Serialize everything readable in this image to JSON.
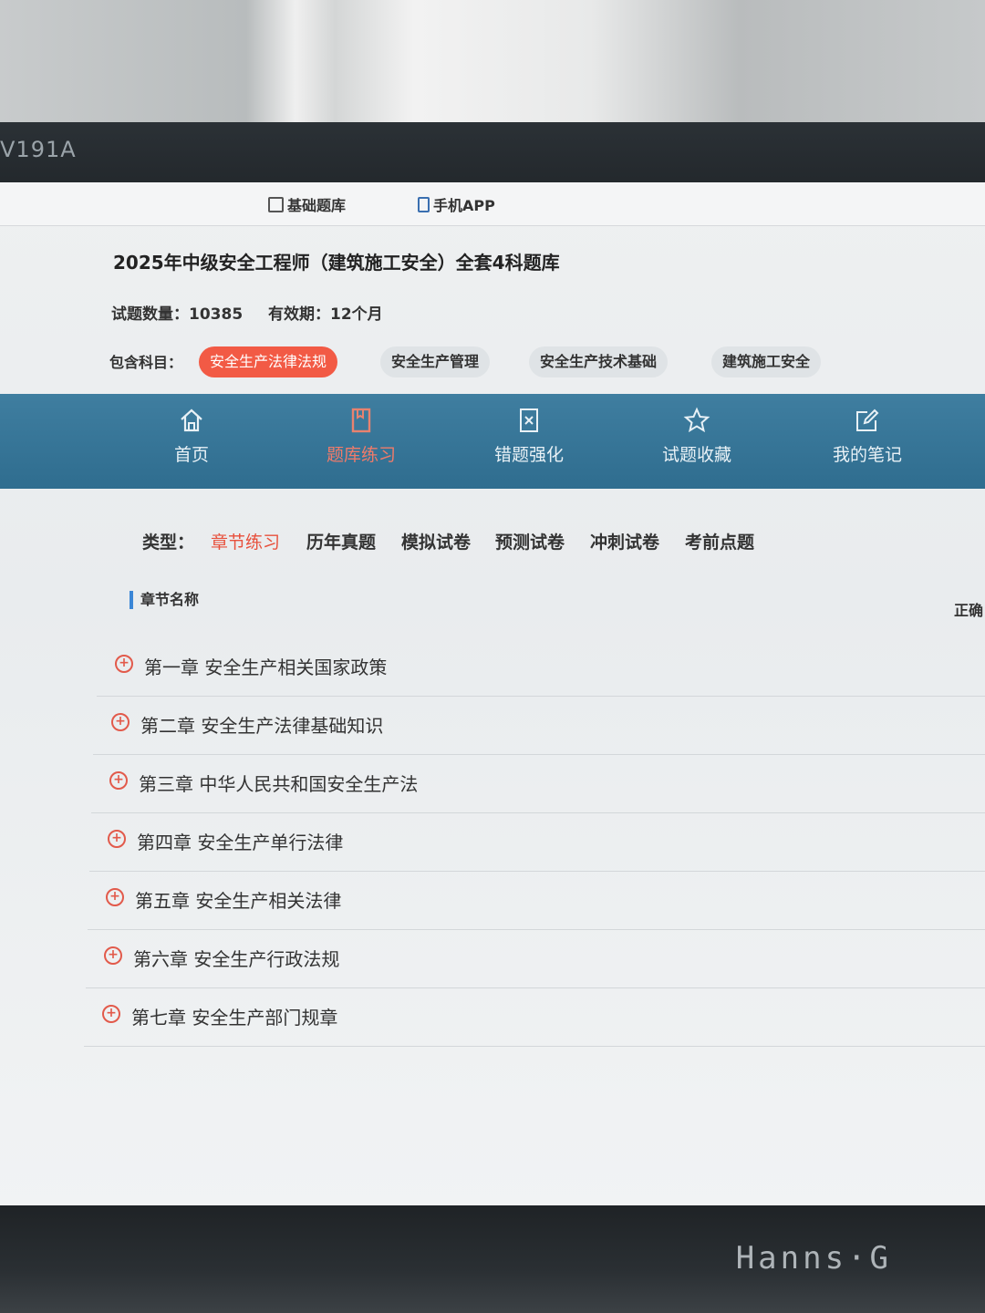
{
  "monitor": {
    "model": "V191A",
    "brand": "Hanns·G"
  },
  "top_links": [
    {
      "label": "基础题库",
      "icon": "list-icon"
    },
    {
      "label": "手机APP",
      "icon": "phone-icon"
    }
  ],
  "course": {
    "title": "2025年中级安全工程师（建筑施工安全）全套4科题库",
    "question_count": "试题数量：10385",
    "validity": "有效期：12个月",
    "subjects_label": "包含科目：",
    "subjects": [
      "安全生产法律法规",
      "安全生产管理",
      "安全生产技术基础",
      "建筑施工安全"
    ],
    "active_subject": 0
  },
  "nav": [
    {
      "label": "首页",
      "icon": "home-icon"
    },
    {
      "label": "题库练习",
      "icon": "book-icon"
    },
    {
      "label": "错题强化",
      "icon": "error-icon"
    },
    {
      "label": "试题收藏",
      "icon": "star-icon"
    },
    {
      "label": "我的笔记",
      "icon": "edit-icon"
    }
  ],
  "types": {
    "label": "类型：",
    "tabs": [
      "章节练习",
      "历年真题",
      "模拟试卷",
      "预测试卷",
      "冲刺试卷",
      "考前点题"
    ],
    "active": 0
  },
  "table": {
    "header": "章节名称",
    "right_col": "正确",
    "chapters": [
      "第一章 安全生产相关国家政策",
      "第二章 安全生产法律基础知识",
      "第三章 中华人民共和国安全生产法",
      "第四章 安全生产单行法律",
      "第五章 安全生产相关法律",
      "第六章 安全生产行政法规",
      "第七章 安全生产部门规章"
    ]
  },
  "colors": {
    "accent": "#f25a45",
    "nav_bg": "#3f7ea0",
    "header_bar": "#3a86d6"
  }
}
